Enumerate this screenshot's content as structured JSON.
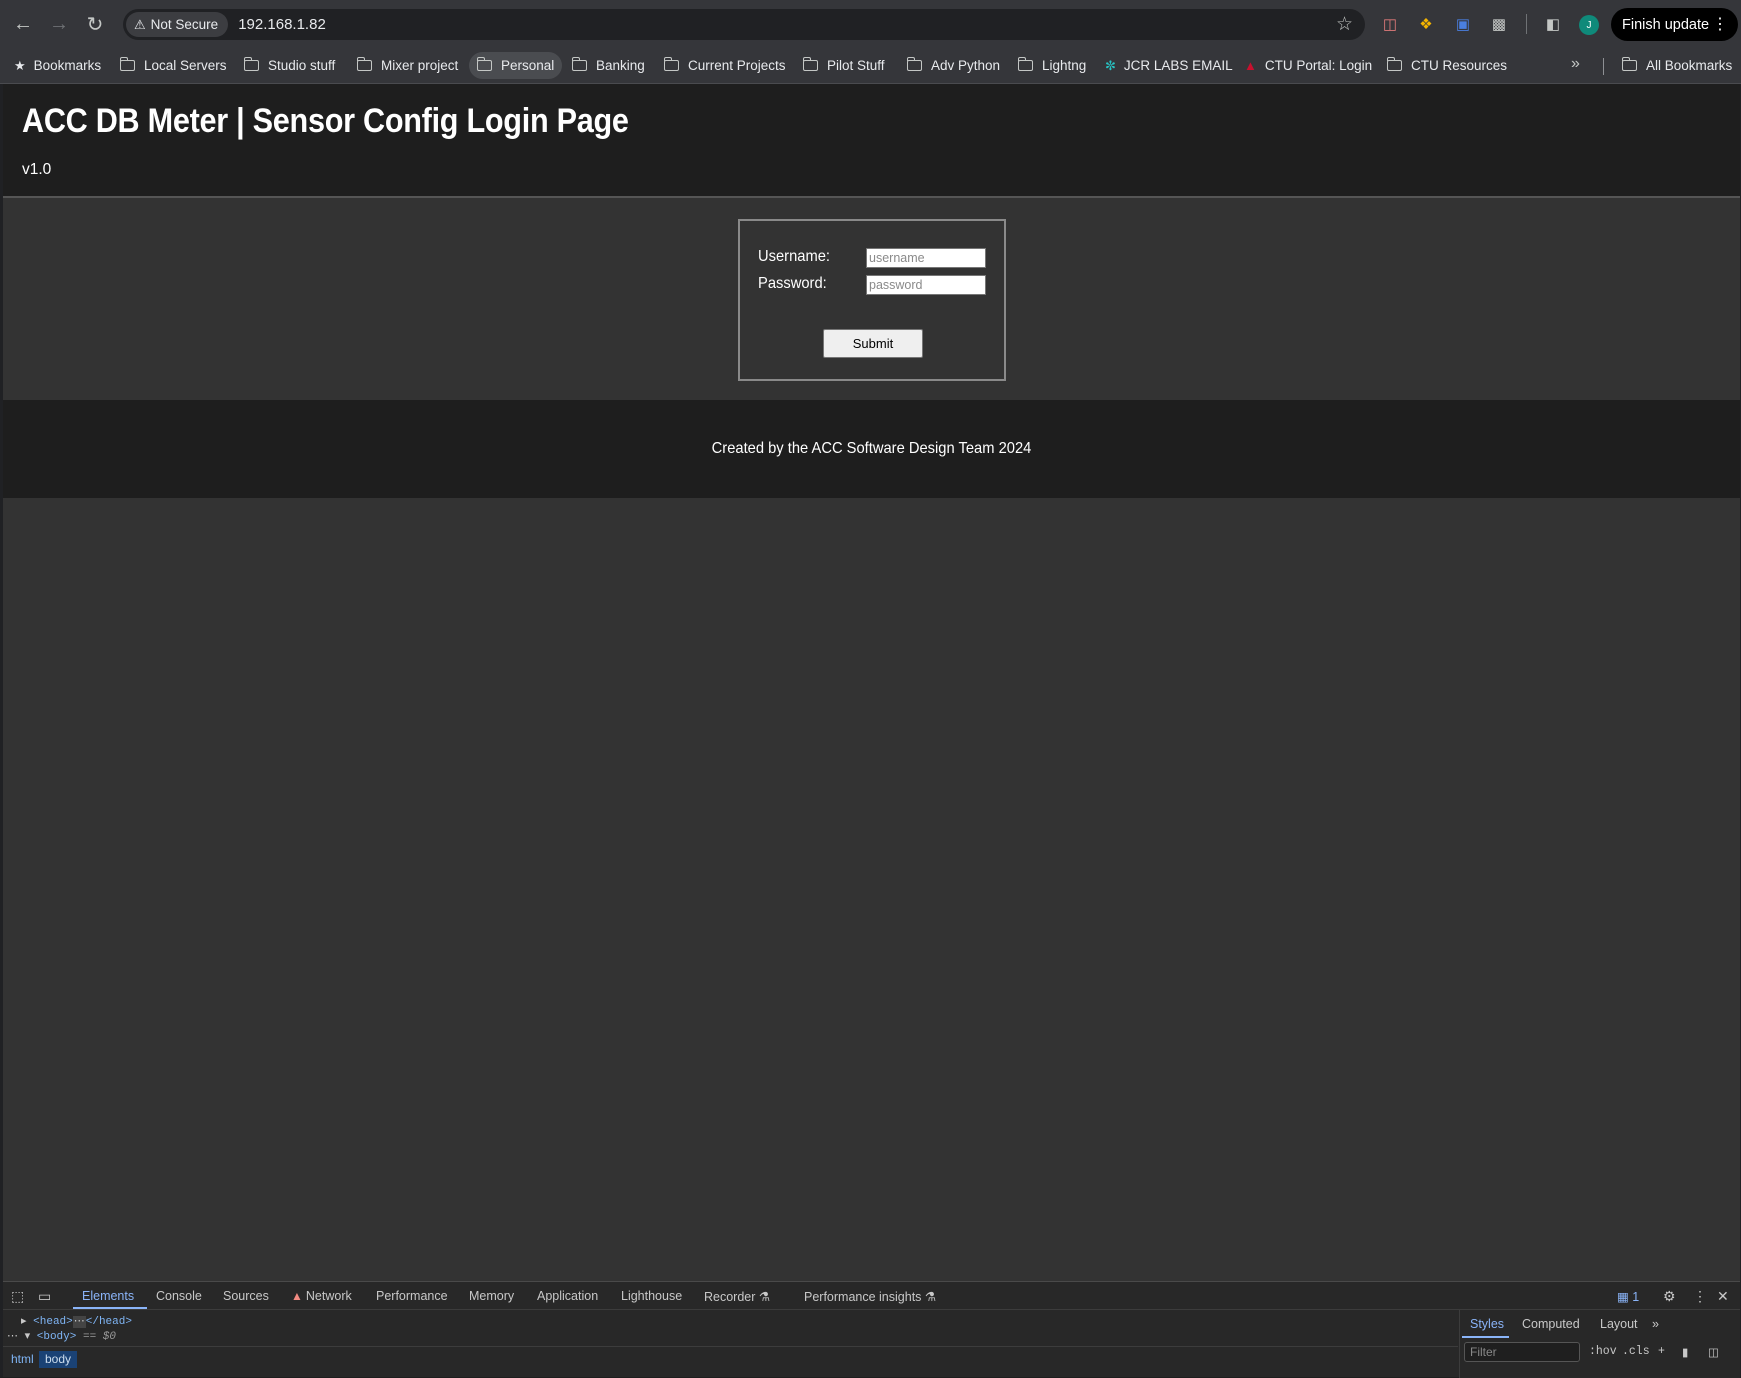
{
  "browser": {
    "security_label": "Not Secure",
    "url": "192.168.1.82",
    "finish_update_label": "Finish update",
    "profile_initial": "J"
  },
  "bookmarks": {
    "items": [
      {
        "label": "Bookmarks",
        "icon": "star-icon"
      },
      {
        "label": "Local Servers",
        "icon": "folder-icon"
      },
      {
        "label": "Studio stuff",
        "icon": "folder-icon"
      },
      {
        "label": "Mixer project",
        "icon": "folder-icon"
      },
      {
        "label": "Personal",
        "icon": "folder-icon"
      },
      {
        "label": "Banking",
        "icon": "folder-icon"
      },
      {
        "label": "Current Projects",
        "icon": "folder-icon"
      },
      {
        "label": "Pilot Stuff",
        "icon": "folder-icon"
      },
      {
        "label": "Adv Python",
        "icon": "folder-icon"
      },
      {
        "label": "Lightng",
        "icon": "folder-icon"
      },
      {
        "label": "JCR LABS EMAIL",
        "icon": "swirl-icon"
      },
      {
        "label": "CTU Portal: Login",
        "icon": "ctu-logo-icon"
      },
      {
        "label": "CTU Resources",
        "icon": "folder-icon"
      }
    ],
    "all_bookmarks_label": "All Bookmarks"
  },
  "page": {
    "title": "ACC DB Meter | Sensor Config Login Page",
    "version": "v1.0",
    "form": {
      "username_label": "Username:",
      "username_placeholder": "username",
      "password_label": "Password:",
      "password_placeholder": "password",
      "submit_label": "Submit"
    },
    "footer": "Created by the ACC Software Design Team 2024"
  },
  "devtools": {
    "tabs": [
      "Elements",
      "Console",
      "Sources",
      "Network",
      "Performance",
      "Memory",
      "Application",
      "Lighthouse",
      "Recorder",
      "Performance insights"
    ],
    "active_tab": "Elements",
    "issues_count": "1",
    "dom": {
      "head_open": "<head>",
      "head_close": "</head>",
      "body_open": "<body>",
      "selected_marker": "== $0"
    },
    "breadcrumbs": [
      "html",
      "body"
    ],
    "styles_tabs": [
      "Styles",
      "Computed",
      "Layout"
    ],
    "filter_placeholder": "Filter",
    "hov_label": ":hov",
    "cls_label": ".cls"
  },
  "colors": {
    "header_bg": "#1e1e1e",
    "page_bg": "#333333",
    "accent": "#8ab4f8"
  }
}
